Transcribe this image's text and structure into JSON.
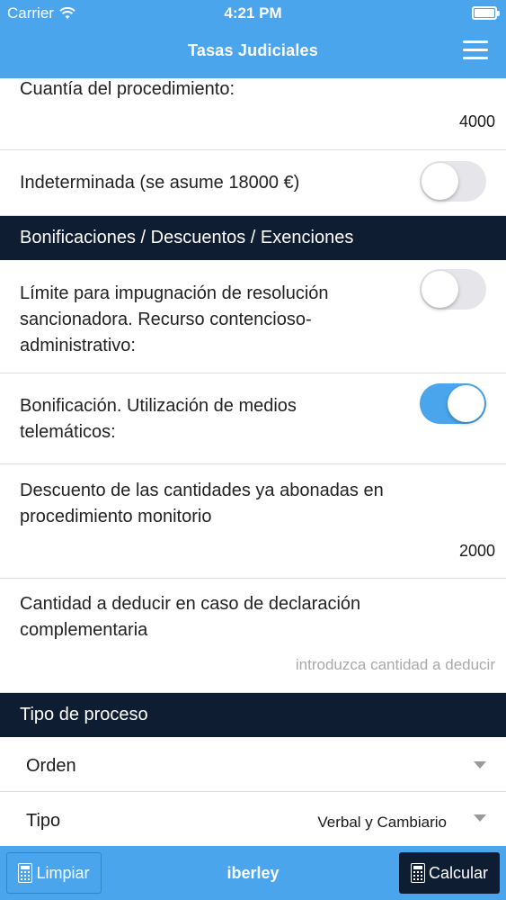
{
  "status_bar": {
    "carrier": "Carrier",
    "time": "4:21 PM",
    "wifi_icon": "wifi-icon",
    "battery_level": 1.0
  },
  "header": {
    "title": "Tasas Judiciales",
    "menu_icon": "hamburger-menu-icon"
  },
  "fields": {
    "cuantia": {
      "label": "Cuantía del procedimiento:",
      "value": "4000"
    },
    "indeterminada": {
      "label": "Indeterminada (se asume 18000 €)",
      "on": false
    },
    "limite": {
      "label_line1": "Límite para impugnación de resolución",
      "label_line2": "sancionadora. Recurso contencioso-",
      "label_line3": "administrativo:",
      "on": false
    },
    "bonificacion": {
      "label_line1": "Bonificación. Utilización de medios",
      "label_line2": "telemáticos:",
      "on": true
    },
    "descuento": {
      "label_line1": "Descuento de las cantidades ya abonadas en",
      "label_line2": "procedimiento monitorio",
      "value": "2000"
    },
    "deducir": {
      "label_line1": "Cantidad a deducir en caso de declaración",
      "label_line2": "complementaria",
      "placeholder": "introduzca cantidad a deducir"
    }
  },
  "sections": {
    "bonificaciones": "Bonificaciones / Descuentos / Exenciones",
    "tipo_proceso": "Tipo de proceso"
  },
  "selects": {
    "orden": {
      "label": "Orden",
      "value": ""
    },
    "tipo": {
      "label": "Tipo",
      "value": "Verbal y Cambiario"
    }
  },
  "footer": {
    "clear_label": "Limpiar",
    "brand": "iberley",
    "calc_label": "Calcular"
  },
  "colors": {
    "accent": "#4aa5ec",
    "section_bg": "#0f1d33"
  }
}
